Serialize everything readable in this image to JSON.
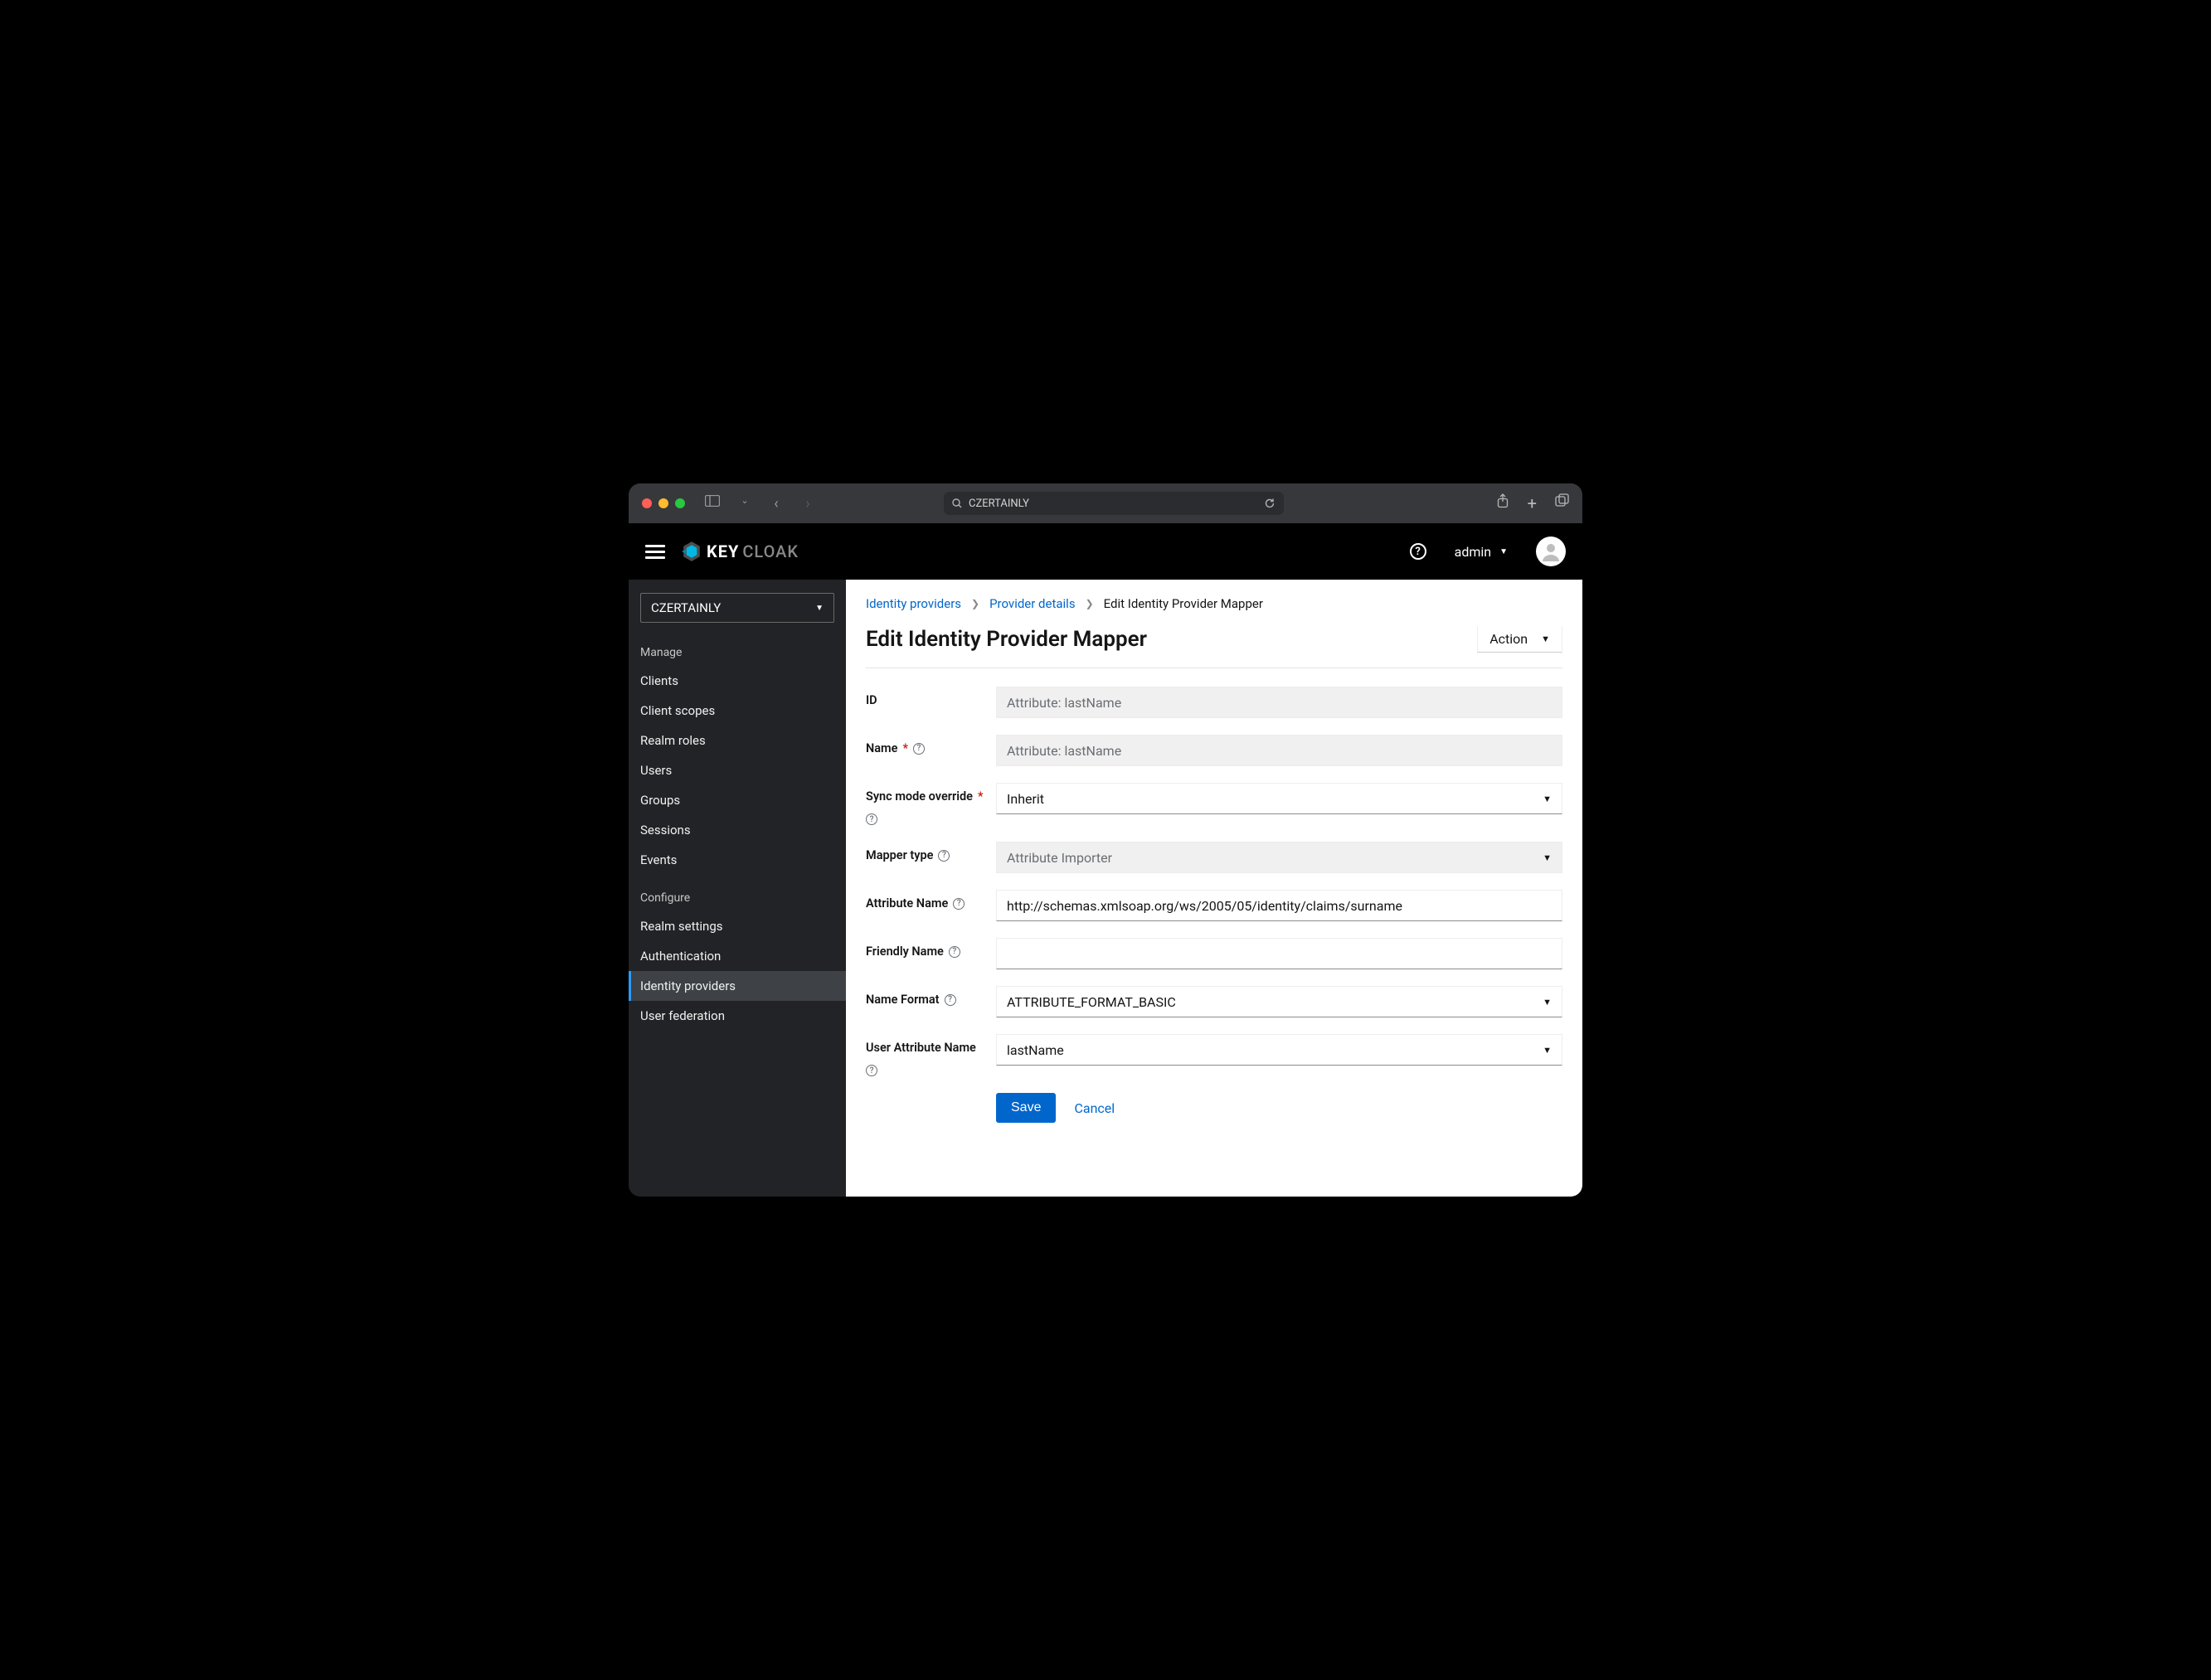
{
  "browser": {
    "url_text": "CZERTAINLY"
  },
  "header": {
    "logo_part1": "KEY",
    "logo_part2": "CLOAK",
    "username": "admin"
  },
  "sidebar": {
    "realm": "CZERTAINLY",
    "section_manage": "Manage",
    "section_configure": "Configure",
    "manage_items": [
      {
        "label": "Clients"
      },
      {
        "label": "Client scopes"
      },
      {
        "label": "Realm roles"
      },
      {
        "label": "Users"
      },
      {
        "label": "Groups"
      },
      {
        "label": "Sessions"
      },
      {
        "label": "Events"
      }
    ],
    "configure_items": [
      {
        "label": "Realm settings"
      },
      {
        "label": "Authentication"
      },
      {
        "label": "Identity providers"
      },
      {
        "label": "User federation"
      }
    ]
  },
  "breadcrumb": {
    "item1": "Identity providers",
    "item2": "Provider details",
    "item3": "Edit Identity Provider Mapper"
  },
  "page": {
    "title": "Edit Identity Provider Mapper",
    "action_label": "Action"
  },
  "form": {
    "id_label": "ID",
    "id_value": "Attribute: lastName",
    "name_label": "Name",
    "name_value": "Attribute: lastName",
    "sync_label": "Sync mode override",
    "sync_value": "Inherit",
    "mapper_type_label": "Mapper type",
    "mapper_type_value": "Attribute Importer",
    "attr_name_label": "Attribute Name",
    "attr_name_value": "http://schemas.xmlsoap.org/ws/2005/05/identity/claims/surname",
    "friendly_label": "Friendly Name",
    "friendly_value": "",
    "name_format_label": "Name Format",
    "name_format_value": "ATTRIBUTE_FORMAT_BASIC",
    "user_attr_label": "User Attribute Name",
    "user_attr_value": "lastName",
    "save": "Save",
    "cancel": "Cancel"
  }
}
